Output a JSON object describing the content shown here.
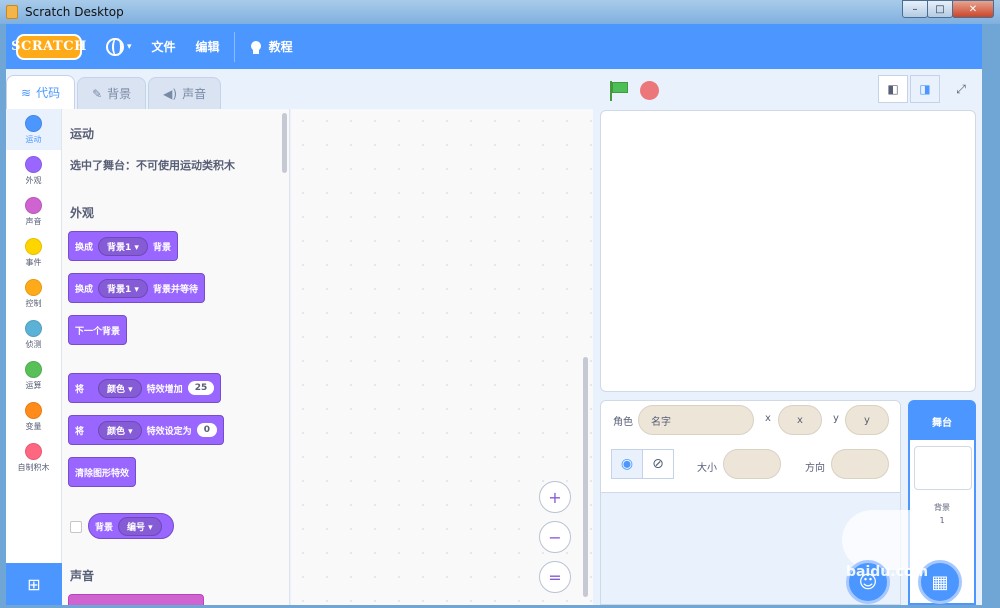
{
  "window": {
    "title": "Scratch Desktop",
    "min": "–",
    "max": "□",
    "close": "✕"
  },
  "menubar": {
    "logo": "SCRATCH",
    "language_caret": "▾",
    "file": "文件",
    "edit": "编辑",
    "tutorials": "教程"
  },
  "tabs": [
    {
      "label": "代码",
      "icon": "code-icon"
    },
    {
      "label": "背景",
      "icon": "brush-icon"
    },
    {
      "label": "声音",
      "icon": "speaker-icon"
    }
  ],
  "categories": [
    {
      "label": "运动",
      "color": "#4c97ff"
    },
    {
      "label": "外观",
      "color": "#9966ff"
    },
    {
      "label": "声音",
      "color": "#cf63cf"
    },
    {
      "label": "事件",
      "color": "#ffd500"
    },
    {
      "label": "控制",
      "color": "#ffab19"
    },
    {
      "label": "侦测",
      "color": "#5cb1d6"
    },
    {
      "label": "运算",
      "color": "#59c059"
    },
    {
      "label": "变量",
      "color": "#ff8c1a"
    },
    {
      "label": "自制积木",
      "color": "#ff6680"
    }
  ],
  "palette": {
    "motion_title": "运动",
    "motion_note": "选中了舞台：不可使用运动类积木",
    "looks_title": "外观",
    "sound_title": "声音",
    "blocks": {
      "switch1_a": "换成",
      "switch1_dd": "背景1 ▾",
      "switch1_b": "背景",
      "switch2_a": "换成",
      "switch2_dd": "背景1 ▾",
      "switch2_b": "背景并等待",
      "next": "下一个背景",
      "effect_change_a": "将",
      "effect_change_dd": "颜色 ▾",
      "effect_change_b": "特效增加",
      "effect_change_val": "25",
      "effect_set_a": "将",
      "effect_set_dd": "颜色 ▾",
      "effect_set_b": "特效设定为",
      "effect_set_val": "0",
      "clear": "清除图形特效",
      "reporter_a": "背景",
      "reporter_dd": "编号 ▾"
    }
  },
  "zoom": {
    "in": "+",
    "out": "−",
    "reset": "="
  },
  "sprite_info": {
    "sprite_label": "角色",
    "name_placeholder": "名字",
    "x_label": "x",
    "x_placeholder": "x",
    "y_label": "y",
    "y_placeholder": "y",
    "size_label": "大小",
    "direction_label": "方向"
  },
  "stage_target": {
    "title": "舞台",
    "backdrops_label": "背景",
    "backdrops_count": "1"
  },
  "watermark": "baidu.com"
}
